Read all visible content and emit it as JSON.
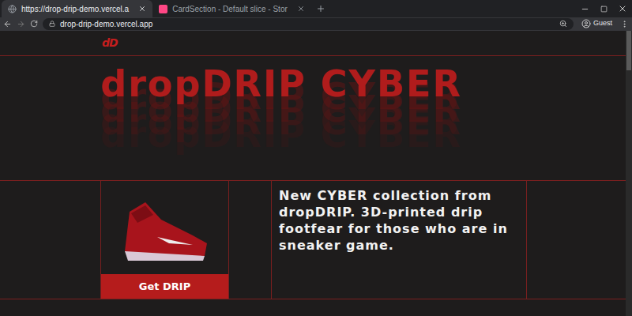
{
  "browser": {
    "tabs": [
      {
        "label": "https://drop-drip-demo.vercel.a",
        "selected": true,
        "kind": "globe"
      },
      {
        "label": "CardSection - Default slice - Stor",
        "selected": false,
        "kind": "storybook"
      }
    ],
    "address": "drop-drip-demo.vercel.app",
    "profile": "Guest"
  },
  "page": {
    "logo": "dD",
    "hero_title": "dropDRIP CYBER",
    "card": {
      "button": "Get DRIP"
    },
    "description": "New CYBER collection from dropDRIP. 3D-printed drip footfear for those who are in sneaker game."
  }
}
